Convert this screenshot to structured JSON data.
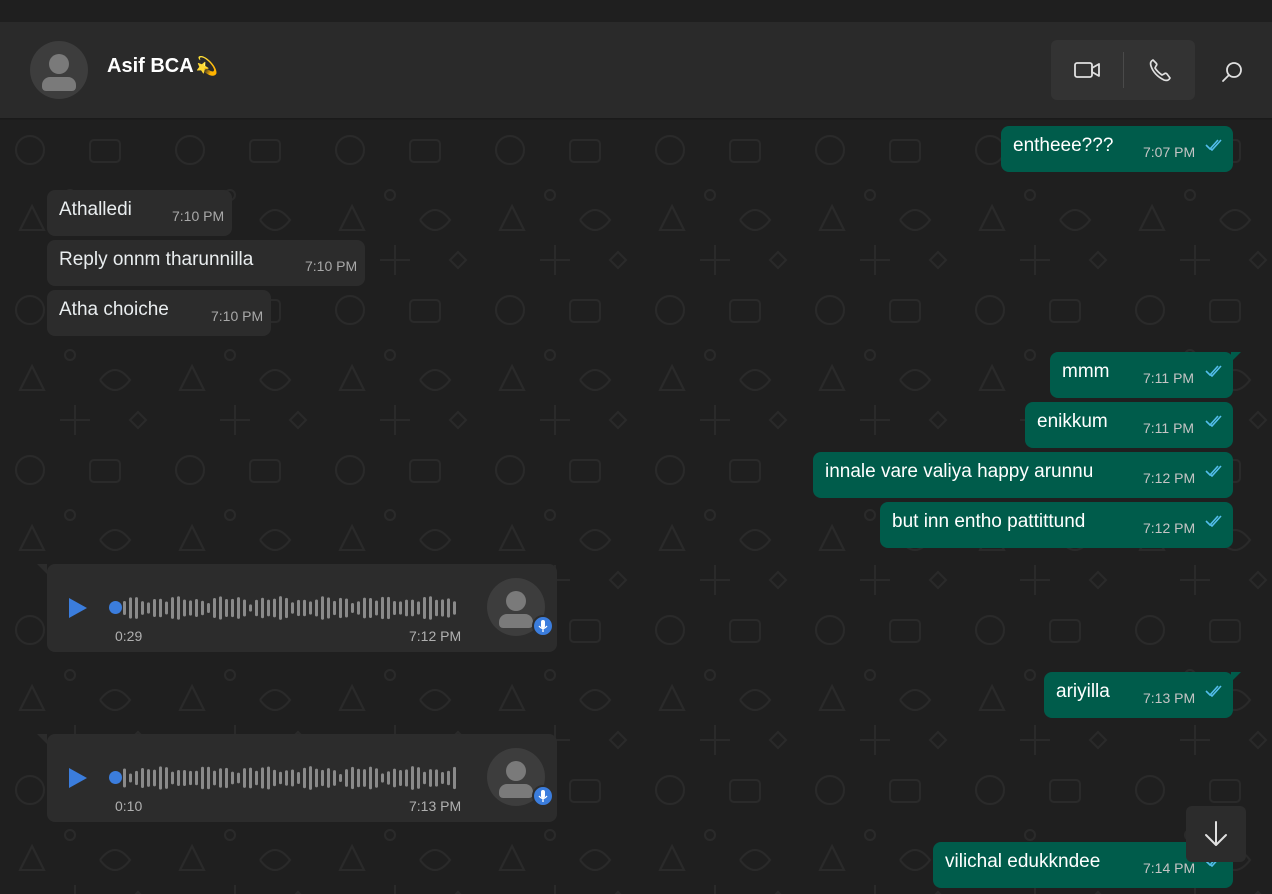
{
  "header": {
    "contact_name": "Asif BCA",
    "contact_emoji": "💫"
  },
  "icons": {
    "video": "video-call-icon",
    "call": "voice-call-icon",
    "search": "search-icon",
    "scroll": "arrow-down-icon"
  },
  "colors": {
    "outgoing_bubble": "#005c4b",
    "incoming_bubble": "#2c2c2c",
    "read_ticks": "#53bdeb",
    "accent_blue": "#3b7ddd"
  },
  "messages": [
    {
      "dir": "out",
      "text": "entheee???",
      "time": "7:07 PM"
    },
    {
      "dir": "in",
      "text": "Athalledi",
      "time": "7:10 PM"
    },
    {
      "dir": "in",
      "text": "Reply onnm tharunnilla",
      "time": "7:10 PM"
    },
    {
      "dir": "in",
      "text": "Atha choiche",
      "time": "7:10 PM"
    },
    {
      "dir": "out",
      "text": "mmm",
      "time": "7:11 PM"
    },
    {
      "dir": "out",
      "text": "enikkum",
      "time": "7:11 PM"
    },
    {
      "dir": "out",
      "text": "innale vare valiya happy arunnu",
      "time": "7:12 PM"
    },
    {
      "dir": "out",
      "text": "but inn entho pattittund",
      "time": "7:12 PM"
    },
    {
      "dir": "in",
      "type": "voice",
      "duration": "0:29",
      "time": "7:12 PM"
    },
    {
      "dir": "out",
      "text": "ariyilla",
      "time": "7:13 PM"
    },
    {
      "dir": "in",
      "type": "voice",
      "duration": "0:10",
      "time": "7:13 PM"
    },
    {
      "dir": "out",
      "text": "vilichal edukkndee",
      "time": "7:14 PM"
    }
  ]
}
